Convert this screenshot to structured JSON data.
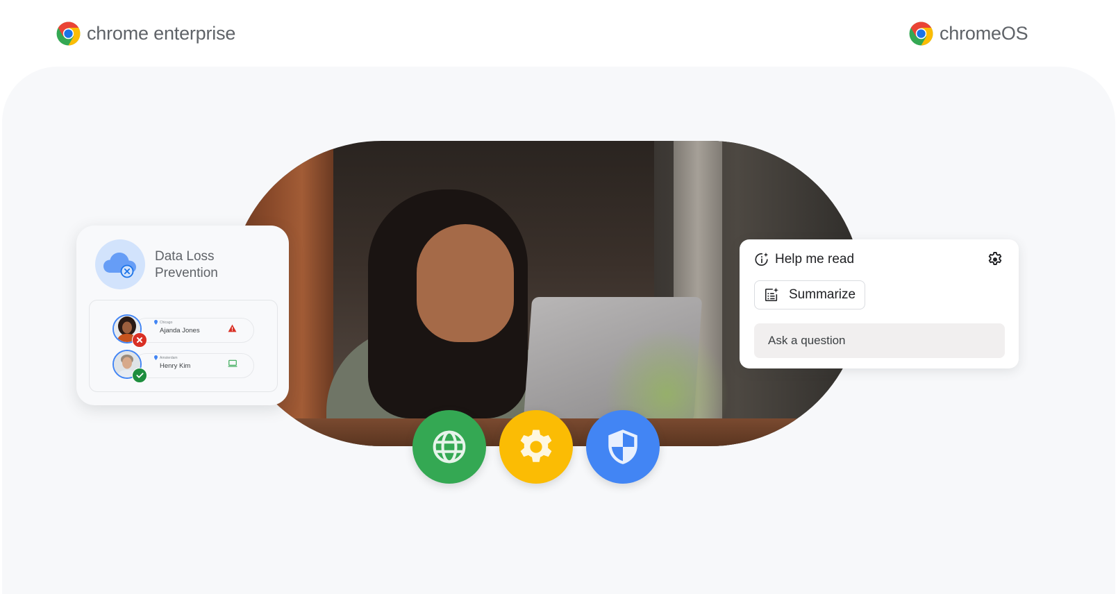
{
  "header": {
    "left_logo": {
      "icon": "chrome-logo-icon",
      "text": "chrome enterprise"
    },
    "right_logo": {
      "icon": "chrome-logo-icon",
      "text": "chromeOS"
    }
  },
  "colors": {
    "google_blue": "#4285f4",
    "google_red": "#ea4335",
    "google_yellow": "#fbbc04",
    "google_green": "#34a853",
    "panel_background": "#f7f8fa"
  },
  "hero_photo": {
    "description": "Woman smiling while working on a laptop in a cafe"
  },
  "dlp_card": {
    "icon": "cloud-blocked-icon",
    "title_line1": "Data Loss",
    "title_line2": "Prevention",
    "users": [
      {
        "location": "Chicago",
        "name": "Ajanda Jones",
        "badge": "x-icon",
        "badge_color": "#d93025",
        "status_icon": "warning-icon",
        "status_color": "#d93025"
      },
      {
        "location": "Amsterdam",
        "name": "Henry Kim",
        "badge": "check-icon",
        "badge_color": "#1e8e3e",
        "status_icon": "laptop-icon",
        "status_color": "#34a853"
      }
    ]
  },
  "help_me_read": {
    "icon": "info-sparkle-icon",
    "title": "Help me read",
    "settings_icon": "gear-icon",
    "summarize_label": "Summarize",
    "summarize_icon": "summarize-sparkle-icon",
    "ask_placeholder": "Ask a question"
  },
  "feature_icons": [
    {
      "name": "globe-icon",
      "color": "#34a853"
    },
    {
      "name": "gear-icon",
      "color": "#fbbc04"
    },
    {
      "name": "shield-icon",
      "color": "#4285f4"
    }
  ]
}
